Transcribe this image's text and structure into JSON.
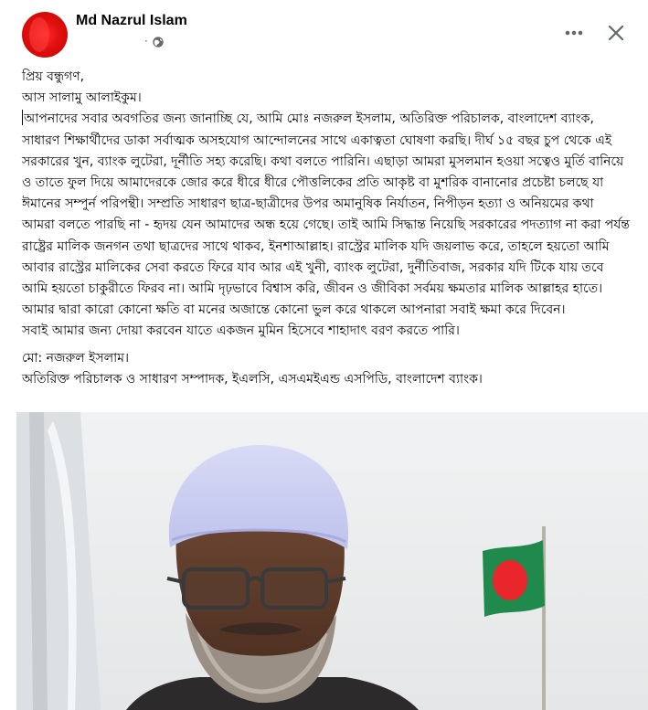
{
  "post": {
    "author": "Md Nazrul Islam",
    "meta_dot": "·",
    "privacy_icon": "globe-icon",
    "more_icon": "more-options-icon",
    "close_icon": "close-icon",
    "text": {
      "greeting": "প্রিয় বন্ধুগণ,",
      "salam": "আস সালামু আলাইকুম।",
      "body": "আপনাদের সবার অবগতির জন্য জানাচ্ছি যে,  আমি মোঃ নজরুল ইসলাম,  অতিরিক্ত পরিচালক, বাংলাদেশ ব্যাংক, সাধারণ শিক্ষার্থীদের ডাকা সর্বাত্মক অসহযোগ আন্দোলনের  সাথে একাত্বতা ঘোষণা করছি।  দীর্ঘ ১৫ বছর চুপ থেকে এই সরকারের খুন, ব্যাংক লুটেরা, দূর্নীতি সহ্য করেছি। কথা বলতে পারিনি। এছাড়া আমরা মুসলমান হওয়া সত্বেও মুর্তি বানিয়ে ও তাতে ফুল দিয়ে আমাদেরকে জোর করে ধীরে ধীরে পৌত্তলিকের প্রতি আকৃষ্ট বা মুশরিক বানানোর প্রচেষ্টা চলছে যা ঈমানের সম্পুর্ন পরিপন্থী।  সম্প্রতি সাধারণ ছাত্র-ছাত্রীদের উপর অমানুষিক নির্যাতন,  নিপীড়ন হত্যা ও অনিয়মের কথা আমরা বলতে পারছি না - হৃদয় যেন আমাদের অন্ধ হয়ে গেছে। তাই আমি সিদ্ধান্ত নিয়েছি সরকারের পদত্যাগ না করা পর্যন্ত রাষ্ট্রের মালিক জনগন তথা ছাত্রদের সাথে থাকব, ইনশাআল্লাহ।  রাস্ট্রের মালিক যদি জয়লাভ করে, তাহলে হয়তো আমি আবার রাস্ট্রের মালিকের সেবা করতে ফিরে যাব  আর এই খুনী, ব্যাংক লুটেরা, দুর্নীতিবাজ,  সরকার যদি টিকে যায় তবে আমি হয়তো চাকুরীতে ফিরব না। আমি দৃঢ়ভাবে বিশ্বাস করি,  জীবন ও জীবিকা সর্বময় ক্ষমতার মালিক আল্লাহর হাতে।",
      "apology": "আমার দ্বারা কারো কোনো ক্ষতি বা মনের অজান্তে কোনো ভুল করে থাকলে আপনারা সবাই ক্ষমা করে দিবেন।",
      "prayer": "সবাই আমার জন্য দোয়া করবেন যাতে একজন মুমিন হিসেবে শাহাদাৎ বরণ করতে পারি।",
      "signature_name": "মো: নজরুল ইসলাম।",
      "signature_title": "অতিরিক্ত পরিচালক ও সাধারণ সম্পাদক,  ইএলসি,  এসএমইএন্ড এসপিডি,  বাংলাদেশ ব্যাংক।"
    },
    "photo": {
      "subject": "man-wearing-white-cap-and-glasses-portrait",
      "flag_colors": {
        "field": "#1f8a4c",
        "disc": "#e8262b"
      },
      "cap_color": "#cfd2f2"
    }
  }
}
